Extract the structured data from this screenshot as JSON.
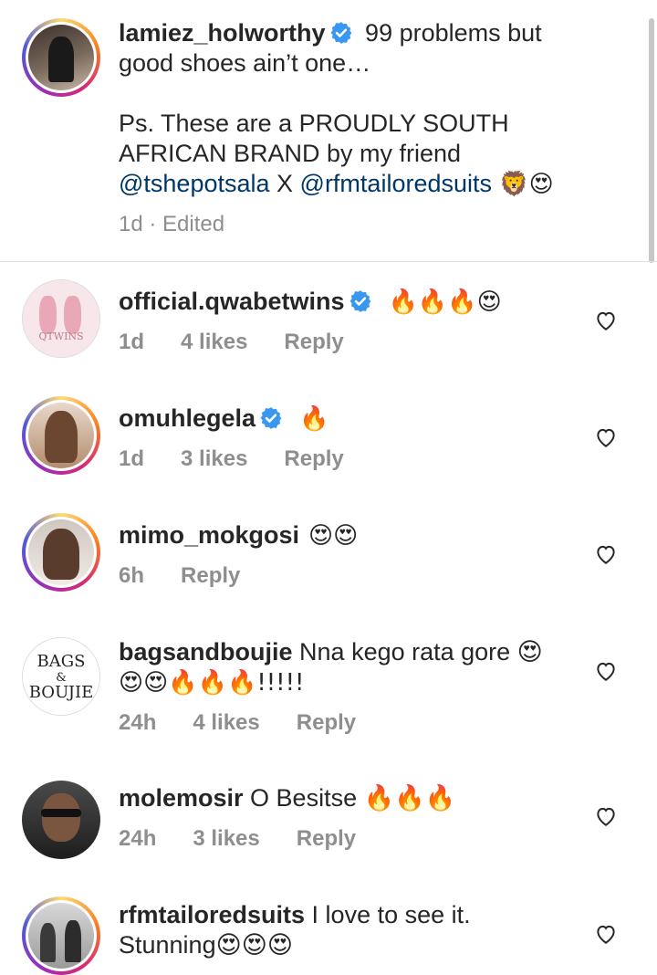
{
  "caption": {
    "username": "lamiez_holworthy",
    "line1": " 99 problems but",
    "line2": "good shoes ain’t one…",
    "line3": "Ps. These are a PROUDLY SOUTH",
    "line4": "AFRICAN BRAND by my friend",
    "mention1": "@tshepotsala",
    "joiner": " X ",
    "mention2": "@rfmtailoredsuits",
    "trail": " 🦁😍",
    "time": "1d",
    "sep": " · ",
    "edited": "Edited"
  },
  "comments": [
    {
      "username": "official.qwabetwins",
      "text": "🔥🔥🔥😍",
      "time": "1d",
      "likes": "4 likes",
      "reply": "Reply"
    },
    {
      "username": "omuhlegela",
      "text": "🔥",
      "time": "1d",
      "likes": "3 likes",
      "reply": "Reply"
    },
    {
      "username": "mimo_mokgosi",
      "text": "😍😍",
      "time": "6h",
      "reply": "Reply"
    },
    {
      "username": "bagsandboujie",
      "text": " Nna kego rata gore 😍",
      "text2": "😍😍🔥🔥🔥!!!!!",
      "time": "24h",
      "likes": "4 likes",
      "reply": "Reply"
    },
    {
      "username": "molemosir",
      "text": " O Besitse 🔥🔥🔥",
      "time": "24h",
      "likes": "3 likes",
      "reply": "Reply"
    },
    {
      "username": "rfmtailoredsuits",
      "text": " I love to see it.",
      "text2": "Stunning😍😍😍"
    }
  ],
  "avatar_text": {
    "bags_line1": "BAGS",
    "bags_amp": "&",
    "bags_line2": "BOUJIE",
    "qtwins": "QTWINS"
  },
  "colors": {
    "username": "#262626",
    "mention": "#00376b",
    "meta": "#8e8e8e",
    "verified": "#3897f0"
  }
}
